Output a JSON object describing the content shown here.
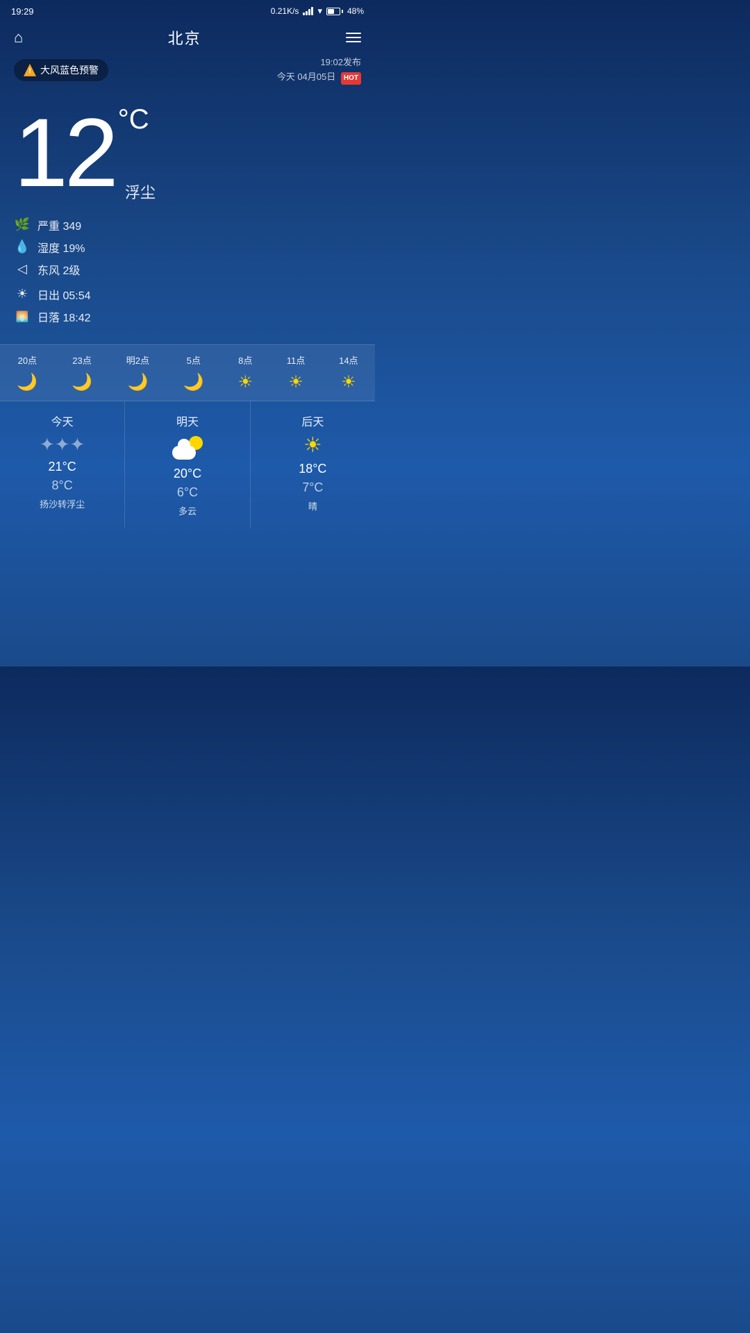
{
  "statusBar": {
    "time": "19:29",
    "network": "0.21K/s",
    "battery": "48%"
  },
  "header": {
    "title": "北京",
    "homeIcon": "⌂",
    "menuLabel": "menu"
  },
  "alert": {
    "badgeText": "大风蓝色预警",
    "publishTime": "19:02发布",
    "date": "今天 04月05日",
    "hotLabel": "HOT"
  },
  "current": {
    "temperature": "12",
    "unit": "°C",
    "description": "浮尘",
    "aqi": {
      "icon": "leaf",
      "label": "严重 349"
    },
    "humidity": {
      "icon": "drop",
      "label": "湿度 19%"
    },
    "wind": {
      "icon": "arrow",
      "label": "东风 2级"
    },
    "sunrise": {
      "icon": "sunrise",
      "label": "日出  05:54"
    },
    "sunset": {
      "icon": "sunset",
      "label": "日落  18:42"
    }
  },
  "hourly": [
    {
      "time": "20点",
      "type": "moon"
    },
    {
      "time": "23点",
      "type": "moon"
    },
    {
      "time": "明2点",
      "type": "moon"
    },
    {
      "time": "5点",
      "type": "moon"
    },
    {
      "time": "8点",
      "type": "sun"
    },
    {
      "time": "11点",
      "type": "sun"
    },
    {
      "time": "14点",
      "type": "sun"
    }
  ],
  "daily": [
    {
      "label": "今天",
      "highTemp": "21°C",
      "lowTemp": "8°C",
      "iconType": "haze",
      "desc": "扬沙转浮尘"
    },
    {
      "label": "明天",
      "highTemp": "20°C",
      "lowTemp": "6°C",
      "iconType": "cloud-sun",
      "desc": "多云"
    },
    {
      "label": "后天",
      "highTemp": "18°C",
      "lowTemp": "7°C",
      "iconType": "sun",
      "desc": "晴"
    }
  ]
}
